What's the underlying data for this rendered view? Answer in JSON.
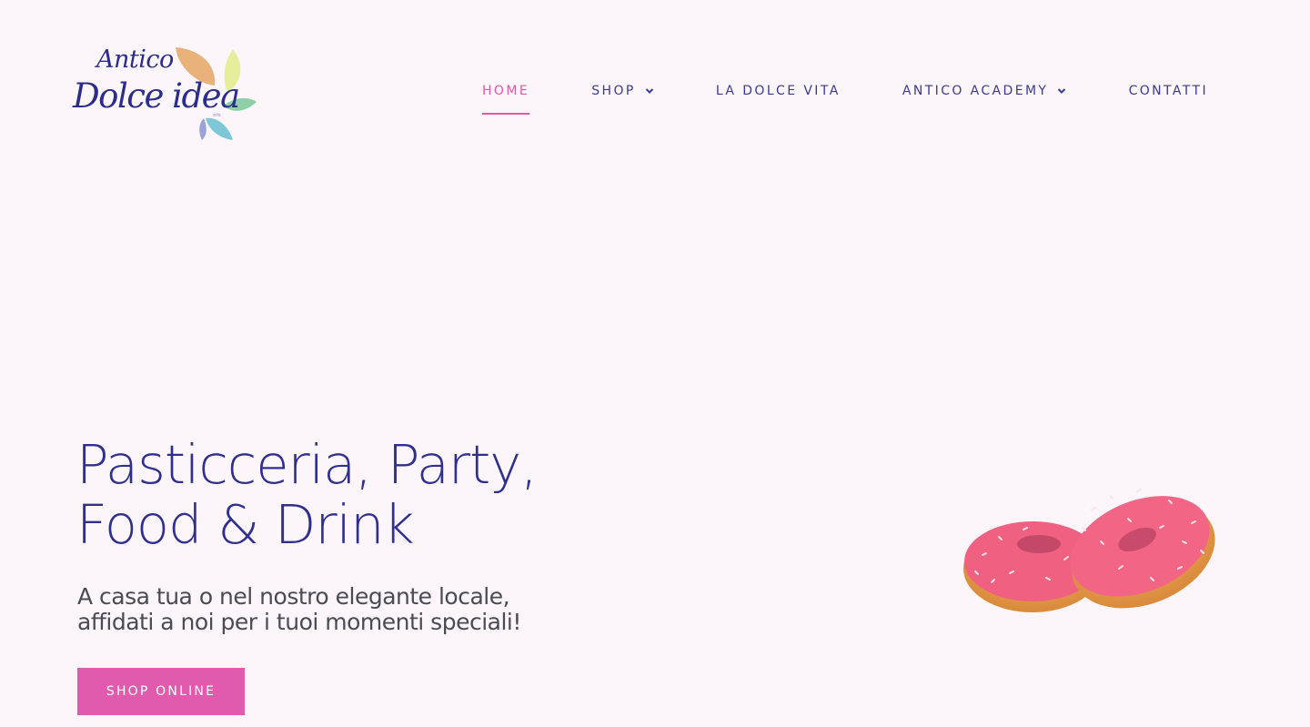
{
  "header": {
    "logo": {
      "line1": "Antico",
      "line2": "Dolce idea",
      "small": "srls"
    },
    "nav": [
      {
        "label": "HOME",
        "active": true,
        "dropdown": false
      },
      {
        "label": "SHOP",
        "active": false,
        "dropdown": true
      },
      {
        "label": "LA DOLCE VITA",
        "active": false,
        "dropdown": false
      },
      {
        "label": "ANTICO ACADEMY",
        "active": false,
        "dropdown": true
      },
      {
        "label": "CONTATTI",
        "active": false,
        "dropdown": false
      }
    ]
  },
  "hero": {
    "title_line1": "Pasticceria, Party,",
    "title_line2": "Food & Drink",
    "subtitle_line1": "A casa tua o nel nostro elegante locale,",
    "subtitle_line2": "affidati a noi per i tuoi momenti speciali!",
    "cta_label": "SHOP ONLINE",
    "image_icon": "donuts-image"
  },
  "colors": {
    "background": "#fcf5f9",
    "navy": "#2e2f8f",
    "accent_pink": "#e05aae",
    "text_gray": "#4b4b55"
  }
}
